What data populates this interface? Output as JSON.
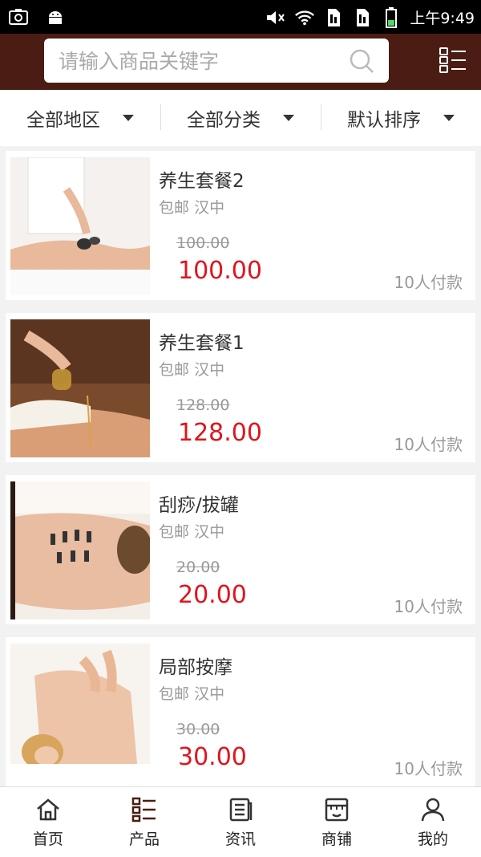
{
  "status_bar": {
    "time": "上午9:49"
  },
  "search": {
    "placeholder": "请输入商品关键字"
  },
  "filters": [
    {
      "label": "全部地区"
    },
    {
      "label": "全部分类"
    },
    {
      "label": "默认排序"
    }
  ],
  "products": [
    {
      "name": "养生套餐2",
      "shipping": "包邮",
      "location": "汉中",
      "original_price": "100.00",
      "price": "100.00",
      "sold": "10人付款",
      "image": "massage-stones"
    },
    {
      "name": "养生套餐1",
      "shipping": "包邮",
      "location": "汉中",
      "original_price": "128.00",
      "price": "128.00",
      "sold": "10人付款",
      "image": "oil-massage"
    },
    {
      "name": "刮痧/拔罐",
      "shipping": "包邮",
      "location": "汉中",
      "original_price": "20.00",
      "price": "20.00",
      "sold": "10人付款",
      "image": "cupping"
    },
    {
      "name": "局部按摩",
      "shipping": "包邮",
      "location": "汉中",
      "original_price": "30.00",
      "price": "30.00",
      "sold": "10人付款",
      "image": "back-massage"
    }
  ],
  "bottom_nav": [
    {
      "label": "首页",
      "icon": "home-icon"
    },
    {
      "label": "产品",
      "icon": "product-list-icon"
    },
    {
      "label": "资讯",
      "icon": "news-icon"
    },
    {
      "label": "商铺",
      "icon": "store-icon"
    },
    {
      "label": "我的",
      "icon": "user-icon"
    }
  ],
  "colors": {
    "header_bg": "#4b1c13",
    "price_red": "#e0141c",
    "status_bar_bg": "#000000"
  }
}
